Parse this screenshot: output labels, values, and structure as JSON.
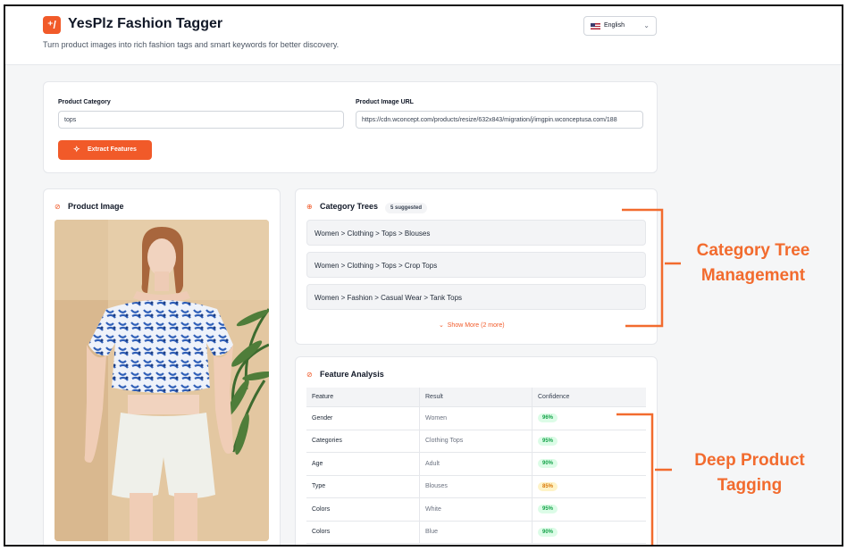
{
  "app": {
    "title": "YesPlz Fashion Tagger",
    "subtitle": "Turn product images into rich fashion tags and smart keywords for better discovery.",
    "logo_icon": "wand-icon",
    "language": "English"
  },
  "form": {
    "category_label": "Product Category",
    "category_value": "tops",
    "url_label": "Product Image URL",
    "url_value": "https://cdn.wconcept.com/products/resize/632x843/migration/j/imgpin.wconceptusa.com/188",
    "extract_button": "Extract Features"
  },
  "product_image": {
    "title": "Product Image"
  },
  "category_trees": {
    "title": "Category Trees",
    "badge": "5 suggested",
    "items": [
      "Women > Clothing > Tops > Blouses",
      "Women > Clothing > Tops > Crop Tops",
      "Women > Fashion > Casual Wear > Tank Tops"
    ],
    "show_more": "Show More (2 more)"
  },
  "feature_analysis": {
    "title": "Feature Analysis",
    "columns": [
      "Feature",
      "Result",
      "Confidence"
    ],
    "rows": [
      {
        "feature": "Gender",
        "result": "Women",
        "confidence": "96%",
        "level": "high"
      },
      {
        "feature": "Categories",
        "result": "Clothing Tops",
        "confidence": "95%",
        "level": "high"
      },
      {
        "feature": "Age",
        "result": "Adult",
        "confidence": "90%",
        "level": "high"
      },
      {
        "feature": "Type",
        "result": "Blouses",
        "confidence": "85%",
        "level": "medium"
      },
      {
        "feature": "Colors",
        "result": "White",
        "confidence": "95%",
        "level": "high"
      },
      {
        "feature": "Colors",
        "result": "Blue",
        "confidence": "90%",
        "level": "high"
      }
    ]
  },
  "annotations": {
    "category": [
      "Category Tree",
      "Management"
    ],
    "tagging": [
      "Deep Product",
      "Tagging"
    ]
  },
  "colors": {
    "accent": "#f15a29",
    "annotation": "#f26b2e",
    "confidence_high": "#16a34a",
    "confidence_medium": "#d97706"
  }
}
